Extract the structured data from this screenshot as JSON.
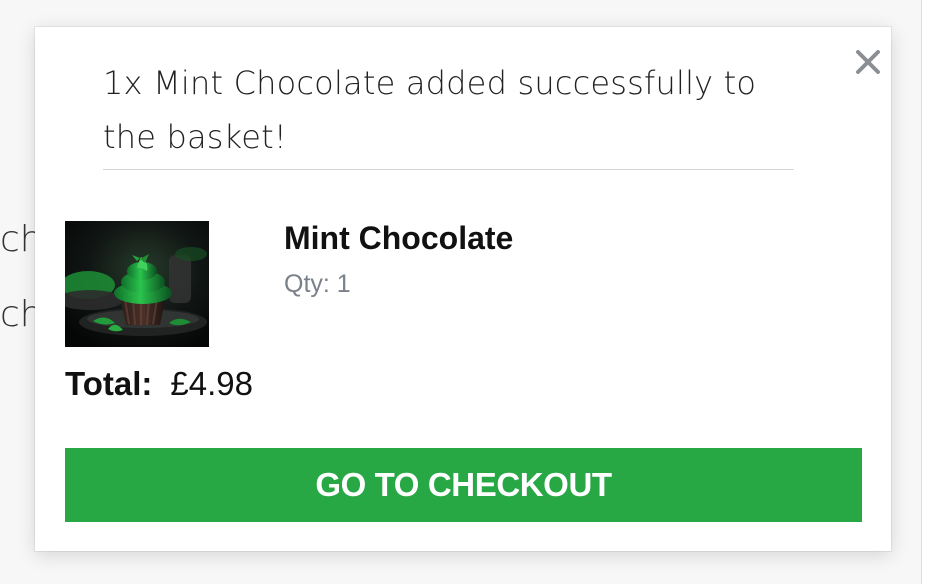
{
  "background": {
    "partial_text_1": "ch",
    "partial_text_2": "ch"
  },
  "modal": {
    "message": "1x Mint Chocolate added successfully to the basket!",
    "close_icon": "close-icon",
    "product": {
      "name": "Mint Chocolate",
      "quantity_text": "Qty: 1",
      "image_icon": "mint-cupcake-image"
    },
    "total": {
      "label": "Total:",
      "value": "£4.98"
    },
    "checkout_button_label": "GO TO CHECKOUT"
  },
  "colors": {
    "button_green": "#28a745",
    "close_gray": "#8b8f94",
    "qty_gray": "#7b818a"
  }
}
